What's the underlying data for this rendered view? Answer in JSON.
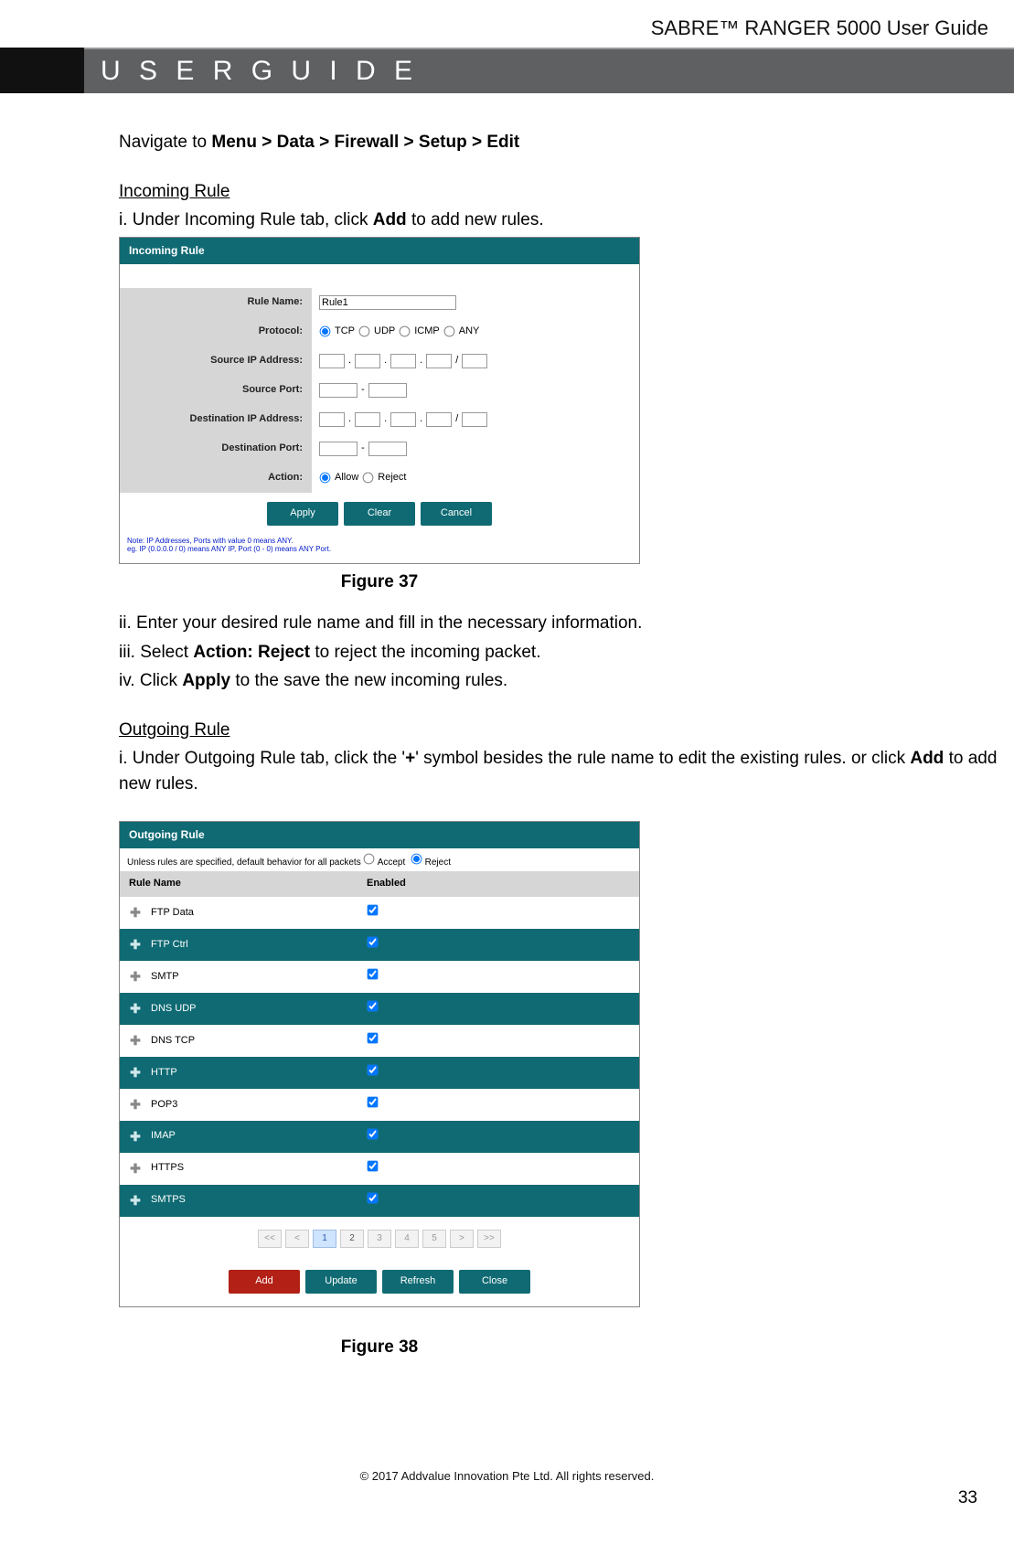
{
  "header": {
    "doc_title": "SABRE™ RANGER 5000 User Guide",
    "banner": "U S E R   G U I D E"
  },
  "nav_intro": {
    "prefix": "Navigate to ",
    "path": "Menu > Data > Firewall > Setup > Edit"
  },
  "incoming": {
    "heading": "Incoming Rule",
    "step_i_pre": "i. Under Incoming Rule tab, click ",
    "step_i_bold": "Add",
    "step_i_post": " to add new rules.",
    "panel_title": "Incoming Rule",
    "labels": {
      "rule_name": "Rule Name:",
      "protocol": "Protocol:",
      "src_ip": "Source IP Address:",
      "src_port": "Source Port:",
      "dst_ip": "Destination IP Address:",
      "dst_port": "Destination Port:",
      "action": "Action:"
    },
    "values": {
      "rule_name_value": "Rule1"
    },
    "protocol_opts": [
      "TCP",
      "UDP",
      "ICMP",
      "ANY"
    ],
    "action_opts": [
      "Allow",
      "Reject"
    ],
    "buttons": [
      "Apply",
      "Clear",
      "Cancel"
    ],
    "note1": "Note: IP Addresses, Ports with value 0 means ANY.",
    "note2": "eg. IP (0.0.0.0 / 0) means ANY IP, Port (0 - 0) means ANY Port.",
    "caption": "Figure 37",
    "step_ii": "ii. Enter your desired rule name and fill in the necessary information.",
    "step_iii_pre": "iii. Select ",
    "step_iii_bold": "Action: Reject",
    "step_iii_post": " to reject the incoming packet.",
    "step_iv_pre": "iv. Click ",
    "step_iv_bold": "Apply",
    "step_iv_post": " to the save the new incoming rules."
  },
  "outgoing": {
    "heading": "Outgoing Rule",
    "step_i_pre": "i. Under Outgoing Rule tab, click the '",
    "step_i_bold": "+",
    "step_i_mid": "' symbol besides the rule name to edit the existing rules. or click ",
    "step_i_bold2": "Add",
    "step_i_post": " to add new rules.",
    "panel_title": "Outgoing Rule",
    "default_note_pre": "Unless rules are specified, default behavior for all packets ",
    "default_opts": [
      "Accept",
      "Reject"
    ],
    "col_rule": "Rule Name",
    "col_enabled": "Enabled",
    "rows": [
      {
        "name": "FTP Data",
        "enabled": true,
        "alt": false
      },
      {
        "name": "FTP Ctrl",
        "enabled": true,
        "alt": true
      },
      {
        "name": "SMTP",
        "enabled": true,
        "alt": false
      },
      {
        "name": "DNS UDP",
        "enabled": true,
        "alt": true
      },
      {
        "name": "DNS TCP",
        "enabled": true,
        "alt": false
      },
      {
        "name": "HTTP",
        "enabled": true,
        "alt": true
      },
      {
        "name": "POP3",
        "enabled": true,
        "alt": false
      },
      {
        "name": "IMAP",
        "enabled": true,
        "alt": true
      },
      {
        "name": "HTTPS",
        "enabled": true,
        "alt": false
      },
      {
        "name": "SMTPS",
        "enabled": true,
        "alt": true
      }
    ],
    "pager": [
      "<<",
      "<",
      "1",
      "2",
      "3",
      "4",
      "5",
      ">",
      ">>"
    ],
    "pager_current": "1",
    "pager_available": [
      "1",
      "2"
    ],
    "buttons": [
      "Add",
      "Update",
      "Refresh",
      "Close"
    ],
    "caption": "Figure 38"
  },
  "footer": {
    "copyright": "© 2017 Addvalue Innovation Pte Ltd. All rights reserved.",
    "page": "33"
  }
}
